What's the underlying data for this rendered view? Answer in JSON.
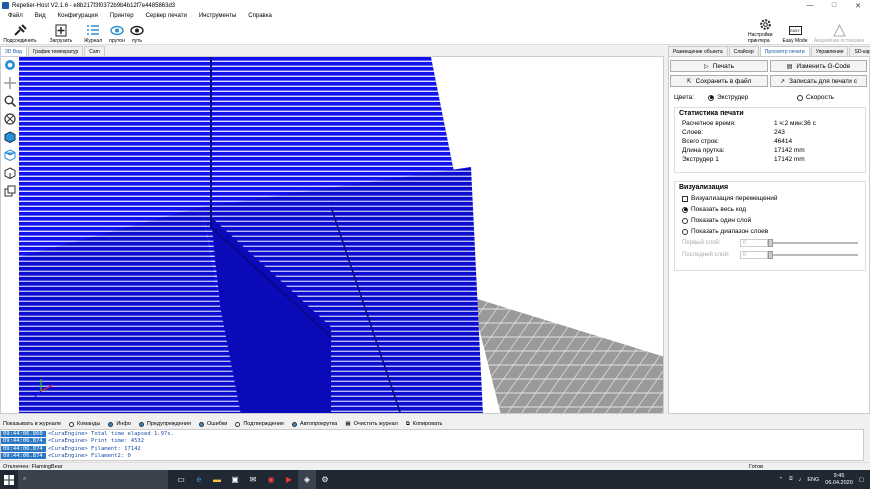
{
  "window": {
    "title": "Repetier-Host V2.1.6 - e8b217f3f0372b9b4b12f7e4485863d3",
    "controls": [
      "—",
      "□",
      "✕"
    ]
  },
  "menu": [
    "Файл",
    "Вид",
    "Конфигурация",
    "Принтер",
    "Сервер печати",
    "Инструменты",
    "Справка"
  ],
  "toolbar": {
    "connect": "Подсоединить",
    "load": "Загрузить",
    "log": "Журнал",
    "show_travel": "прутон",
    "path": "путь",
    "printer_settings": "Настройки принтера",
    "easy_mode": "Easy Mode",
    "emergency": "Аварийная остановка",
    "easy_badge": "EASY"
  },
  "left_tabs": [
    "3D Вид",
    "График температур",
    "Cam"
  ],
  "right_tabs": [
    "Размещение объекта",
    "Слайсер",
    "Просмотр печати",
    "Управление",
    "SD-карта"
  ],
  "right_panel": {
    "print_btn": "Печать",
    "edit_gcode_btn": "Изменить G-Code",
    "save_file_btn": "Сохранить в файл",
    "write_print_btn": "Записать для печати с",
    "colors_label": "Цвета:",
    "color_extruder": "Экструдер",
    "color_speed": "Скорость",
    "stats": {
      "title": "Статистика печати",
      "rows": [
        {
          "k": "Расчетное время:",
          "v": "1 ч:2 мин:36 с"
        },
        {
          "k": "Слоев:",
          "v": "243"
        },
        {
          "k": "Всего строк:",
          "v": "46414"
        },
        {
          "k": "Длина прутка:",
          "v": "17142 mm"
        },
        {
          "k": "Экструдер 1",
          "v": "17142 mm"
        }
      ]
    },
    "vis": {
      "title": "Визуализация",
      "show_travel": "Визуализация перемещений",
      "show_all": "Показать весь код",
      "show_one": "Показать один слой",
      "show_range": "Показать диапазон слоев",
      "first_layer": "Первый слой:",
      "first_value": "0",
      "last_layer": "Последний слой:",
      "last_value": "0"
    }
  },
  "logbar": {
    "show_in_log": "Показывать в журнале",
    "commands": "Команды",
    "info": "Инфо",
    "warnings": "Предупреждения",
    "errors": "Ошибки",
    "ack": "Подтверждение",
    "autoscroll": "Автопрокрутка",
    "clear": "Очистить журнал",
    "copy": "Копировать"
  },
  "log": [
    {
      "ts": "09:44:06.860",
      "msg": "<CuraEngine> Total time elapsed  1.97s."
    },
    {
      "ts": "09:44:06.874",
      "msg": "<CuraEngine> Print time: 4532"
    },
    {
      "ts": "09:44:06.874",
      "msg": "<CuraEngine> Filament: 17142"
    },
    {
      "ts": "09:44:06.874",
      "msg": "<CuraEngine> Filament2: 0"
    }
  ],
  "status": {
    "left": "Отключен: FlamingBear",
    "right": "Готов"
  },
  "taskbar": {
    "search": "",
    "lang": "ENG",
    "time": "9:45",
    "date": "06.04.2020"
  },
  "colors": {
    "blue": "#1a1aff",
    "accent": "#1e5aa8"
  }
}
